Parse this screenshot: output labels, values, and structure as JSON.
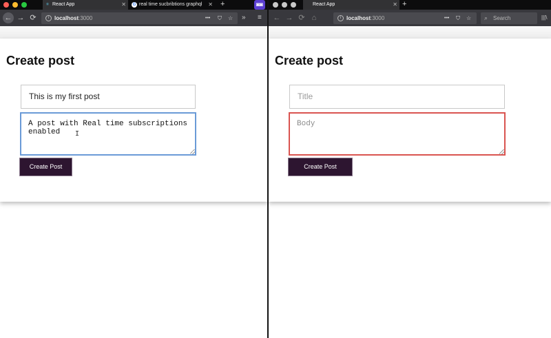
{
  "left_browser": {
    "tabs": [
      {
        "label": "React App",
        "favicon": "react-icon",
        "active": true
      },
      {
        "label": "real time sucbribtions graphql",
        "favicon": "google-icon",
        "active": false
      }
    ],
    "new_tab": "+",
    "nav": {
      "back": "←",
      "forward": "→",
      "reload": "⟳"
    },
    "url": {
      "host": "localhost",
      "port": ":3000"
    },
    "toolbar_icons": {
      "more": "•••",
      "pocket": "⛉",
      "bookmark": "☆",
      "overflow": "»",
      "menu": "≡"
    }
  },
  "right_browser": {
    "tabs": [
      {
        "label": "React App",
        "active": true
      }
    ],
    "new_tab": "+",
    "nav": {
      "back": "←",
      "forward": "→",
      "reload": "⟳",
      "home": "⌂"
    },
    "url": {
      "host": "localhost",
      "port": ":3000"
    },
    "toolbar_icons": {
      "more": "•••",
      "pocket": "⛉",
      "bookmark": "☆",
      "library": "|||\\"
    },
    "search_placeholder": "Search"
  },
  "left_app": {
    "title": "Create post",
    "title_value": "This is my first post",
    "body_value": "A post with Real time subscriptions\nenabled",
    "submit_label": "Create Post",
    "cursor": "I"
  },
  "right_app": {
    "title": "Create post",
    "title_placeholder": "Title",
    "body_placeholder": "Body",
    "submit_label": "Create Post"
  },
  "colors": {
    "tab_bar": "#0c0c0d",
    "toolbar": "#38383d",
    "button_bg": "#2d1530",
    "focus_border": "#6a9ad7",
    "invalid_border": "#d9534f"
  }
}
